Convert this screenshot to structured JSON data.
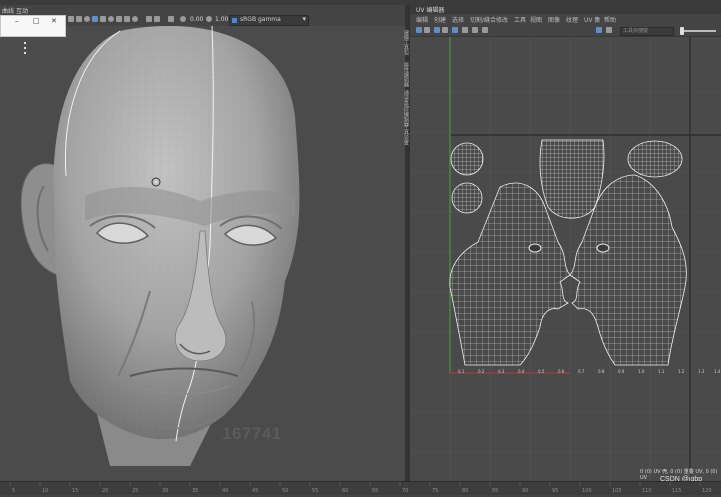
{
  "left_menu": {
    "items": [
      "曲线",
      "互动"
    ]
  },
  "viewport_toolbar": {
    "exposure_value": "0.00",
    "gamma_value": "1.00",
    "color_space": "sRGB gamma"
  },
  "floating_window": {
    "minimize_label": "–",
    "maximize_label": "□",
    "close_label": "✕"
  },
  "viewport": {
    "watermark": "167741"
  },
  "side_tabs": [
    "建模工具包",
    "属性编辑器",
    "通道盒/层编辑器",
    "工具设置"
  ],
  "uv_editor": {
    "title": "UV 编辑器",
    "menu": [
      "编辑",
      "创建",
      "选择",
      "切割/缝合",
      "修改",
      "工具",
      "视图",
      "图像",
      "纹理",
      "UV 集",
      "帮助"
    ],
    "search_placeholder": "工具快捷键",
    "status_text": "0 (0) UV 壳, 0 (0) 重叠 UV, 0 (0) UV",
    "csdn_label": "CSDN @jgbp",
    "grid_labels": [
      "0.1",
      "0.2",
      "0.3",
      "0.4",
      "0.5",
      "0.6",
      "0.7",
      "0.8",
      "0.9",
      "1.0",
      "1.1",
      "1.2",
      "1.3",
      "1.4"
    ]
  },
  "timeline": {
    "tick_labels": [
      "5",
      "10",
      "15",
      "20",
      "25",
      "30",
      "35",
      "40",
      "45",
      "50",
      "55",
      "60",
      "65",
      "70",
      "75",
      "80",
      "85",
      "90",
      "95",
      "100",
      "105",
      "110",
      "115",
      "120"
    ]
  },
  "colors": {
    "background": "#444444",
    "viewport_bg": "#4b4b4b",
    "uv_bg": "#4a4a4a",
    "axis_u": "#c33b3b",
    "axis_v": "#3ea53e",
    "accent_blue": "#4f86c6"
  }
}
